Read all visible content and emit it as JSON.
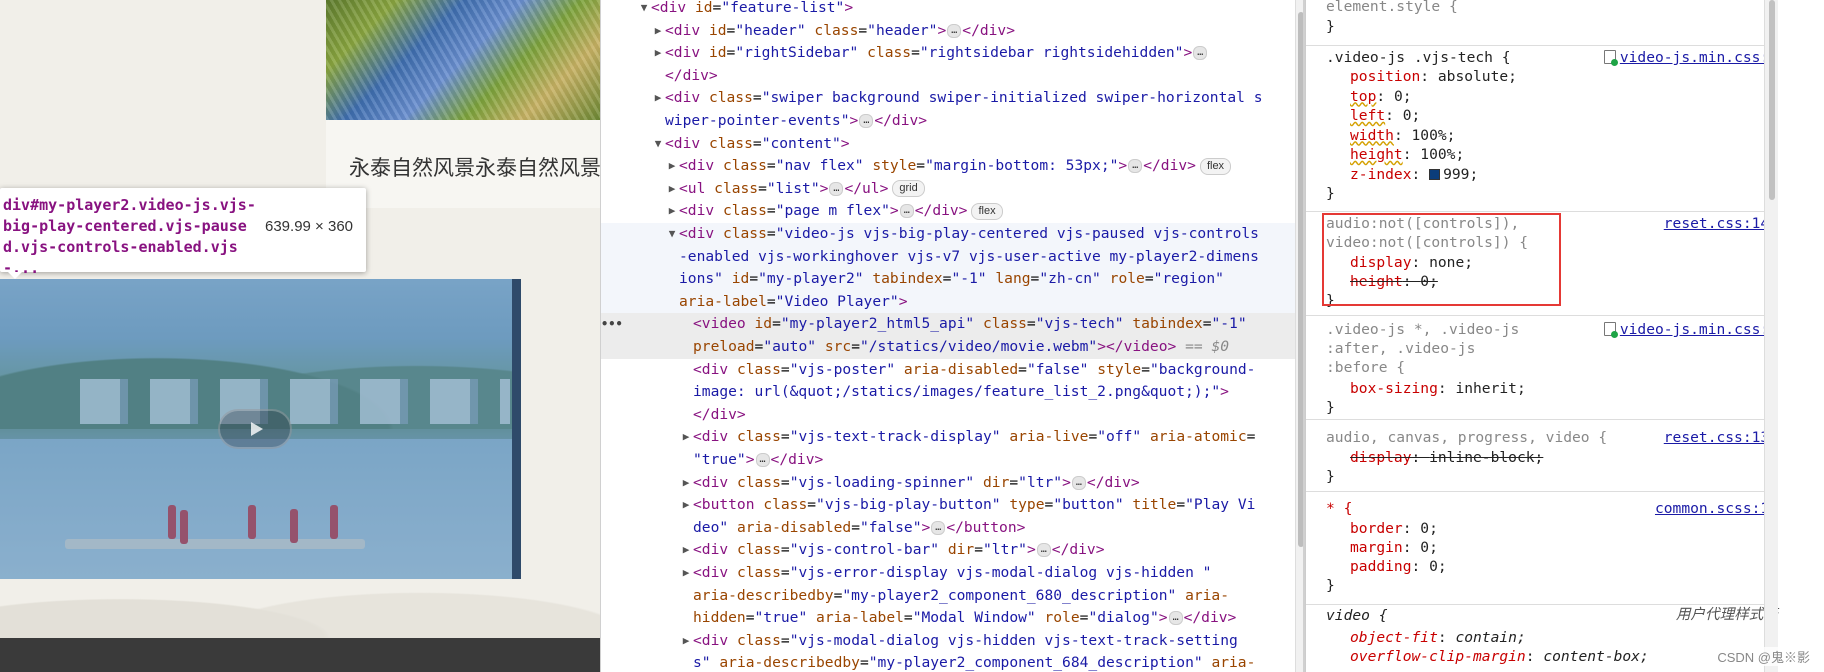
{
  "page": {
    "title_text": "永泰自然风景永泰自然风景"
  },
  "tooltip": {
    "selector": "div#my-player2.video-js.vjs-big-play-centered.vjs-paused.vjs-controls-enabled.vjs-...",
    "dimensions": "639.99 × 360"
  },
  "elements": {
    "rows": [
      {
        "indent": 0,
        "tri": "▼",
        "html": "<span class='t'>&lt;div</span> <span class='an'>id</span>=<span class='av'>\"feature-list\"</span><span class='t'>&gt;</span>"
      },
      {
        "indent": 1,
        "tri": "▶",
        "html": "<span class='t'>&lt;div</span> <span class='an'>id</span>=<span class='av'>\"header\"</span> <span class='an'>class</span>=<span class='av'>\"header\"</span><span class='t'>&gt;</span><span class='ell'>…</span><span class='t'>&lt;/div&gt;</span>"
      },
      {
        "indent": 1,
        "tri": "▶",
        "html": "<span class='t'>&lt;div</span> <span class='an'>id</span>=<span class='av'>\"rightSidebar\"</span> <span class='an'>class</span>=<span class='av'>\"rightsidebar rightsidehidden\"</span><span class='t'>&gt;</span><span class='ell'>…</span>"
      },
      {
        "indent": 1,
        "tri": "",
        "html": "<span class='t'>&lt;/div&gt;</span>"
      },
      {
        "indent": 1,
        "tri": "▶",
        "html": "<span class='t'>&lt;div</span> <span class='an'>class</span>=<span class='av'>\"swiper background swiper-initialized swiper-horizontal s</span>"
      },
      {
        "indent": 1,
        "tri": "",
        "html": "<span class='av'>wiper-pointer-events\"</span><span class='t'>&gt;</span><span class='ell'>…</span><span class='t'>&lt;/div&gt;</span>"
      },
      {
        "indent": 1,
        "tri": "▼",
        "html": "<span class='t'>&lt;div</span> <span class='an'>class</span>=<span class='av'>\"content\"</span><span class='t'>&gt;</span>"
      },
      {
        "indent": 2,
        "tri": "▶",
        "html": "<span class='t'>&lt;div</span> <span class='an'>class</span>=<span class='av'>\"nav flex\"</span> <span class='an'>style</span>=<span class='av'>\"margin-bottom: 53px;\"</span><span class='t'>&gt;</span><span class='ell'>…</span><span class='t'>&lt;/div&gt;</span><span class='badge'>flex</span>"
      },
      {
        "indent": 2,
        "tri": "▶",
        "html": "<span class='t'>&lt;ul</span> <span class='an'>class</span>=<span class='av'>\"list\"</span><span class='t'>&gt;</span><span class='ell'>…</span><span class='t'>&lt;/ul&gt;</span><span class='badge'>grid</span>"
      },
      {
        "indent": 2,
        "tri": "▶",
        "html": "<span class='t'>&lt;div</span> <span class='an'>class</span>=<span class='av'>\"page m flex\"</span><span class='t'>&gt;</span><span class='ell'>…</span><span class='t'>&lt;/div&gt;</span><span class='badge'>flex</span>"
      },
      {
        "indent": 2,
        "tri": "▼",
        "hover": true,
        "html": "<span class='t'>&lt;div</span> <span class='an'>class</span>=<span class='av'>\"video-js vjs-big-play-centered vjs-paused vjs-controls</span>"
      },
      {
        "indent": 2,
        "tri": "",
        "hover": true,
        "html": "<span class='av'>-enabled vjs-workinghover vjs-v7 vjs-user-active my-player2-dimens</span>"
      },
      {
        "indent": 2,
        "tri": "",
        "hover": true,
        "html": "<span class='av'>ions\"</span> <span class='an'>id</span>=<span class='av'>\"my-player2\"</span> <span class='an'>tabindex</span>=<span class='av'>\"-1\"</span> <span class='an'>lang</span>=<span class='av'>\"zh-cn\"</span> <span class='an'>role</span>=<span class='av'>\"region\"</span>"
      },
      {
        "indent": 2,
        "tri": "",
        "hover": true,
        "html": "<span class='an'>aria-label</span>=<span class='av'>\"Video Player\"</span><span class='t'>&gt;</span>"
      },
      {
        "indent": 3,
        "tri": "",
        "sel": true,
        "html": "<span class='t'>&lt;video</span> <span class='an'>id</span>=<span class='av'>\"my-player2_html5_api\"</span> <span class='an'>class</span>=<span class='av'>\"vjs-tech\"</span> <span class='an'>tabindex</span>=<span class='av'>\"-1\"</span>"
      },
      {
        "indent": 3,
        "tri": "",
        "sel": true,
        "html": "<span class='an'>preload</span>=<span class='av'>\"auto\"</span> <span class='an'>src</span>=<span class='av'>\"/statics/video/movie.webm\"</span><span class='t'>&gt;&lt;/video&gt;</span> <span class='eq0'>== $0</span>"
      },
      {
        "indent": 3,
        "tri": "",
        "html": "<span class='t'>&lt;div</span> <span class='an'>class</span>=<span class='av'>\"vjs-poster\"</span> <span class='an'>aria-disabled</span>=<span class='av'>\"false\"</span> <span class='an'>style</span>=<span class='av'>\"background-</span>"
      },
      {
        "indent": 3,
        "tri": "",
        "html": "<span class='av'>image: url(&amp;quot;/statics/images/feature_list_2.png&amp;quot;);\"</span><span class='t'>&gt;</span>"
      },
      {
        "indent": 3,
        "tri": "",
        "html": "<span class='t'>&lt;/div&gt;</span>"
      },
      {
        "indent": 3,
        "tri": "▶",
        "html": "<span class='t'>&lt;div</span> <span class='an'>class</span>=<span class='av'>\"vjs-text-track-display\"</span> <span class='an'>aria-live</span>=<span class='av'>\"off\"</span> <span class='an'>aria-atomic</span>="
      },
      {
        "indent": 3,
        "tri": "",
        "html": "<span class='av'>\"true\"</span><span class='t'>&gt;</span><span class='ell'>…</span><span class='t'>&lt;/div&gt;</span>"
      },
      {
        "indent": 3,
        "tri": "▶",
        "html": "<span class='t'>&lt;div</span> <span class='an'>class</span>=<span class='av'>\"vjs-loading-spinner\"</span> <span class='an'>dir</span>=<span class='av'>\"ltr\"</span><span class='t'>&gt;</span><span class='ell'>…</span><span class='t'>&lt;/div&gt;</span>"
      },
      {
        "indent": 3,
        "tri": "▶",
        "html": "<span class='t'>&lt;button</span> <span class='an'>class</span>=<span class='av'>\"vjs-big-play-button\"</span> <span class='an'>type</span>=<span class='av'>\"button\"</span> <span class='an'>title</span>=<span class='av'>\"Play Vi</span>"
      },
      {
        "indent": 3,
        "tri": "",
        "html": "<span class='av'>deo\"</span> <span class='an'>aria-disabled</span>=<span class='av'>\"false\"</span><span class='t'>&gt;</span><span class='ell'>…</span><span class='t'>&lt;/button&gt;</span>"
      },
      {
        "indent": 3,
        "tri": "▶",
        "html": "<span class='t'>&lt;div</span> <span class='an'>class</span>=<span class='av'>\"vjs-control-bar\"</span> <span class='an'>dir</span>=<span class='av'>\"ltr\"</span><span class='t'>&gt;</span><span class='ell'>…</span><span class='t'>&lt;/div&gt;</span>"
      },
      {
        "indent": 3,
        "tri": "▶",
        "html": "<span class='t'>&lt;div</span> <span class='an'>class</span>=<span class='av'>\"vjs-error-display vjs-modal-dialog vjs-hidden \"</span>"
      },
      {
        "indent": 3,
        "tri": "",
        "html": "<span class='an'>aria-describedby</span>=<span class='av'>\"my-player2_component_680_description\"</span> <span class='an'>aria-</span>"
      },
      {
        "indent": 3,
        "tri": "",
        "html": "<span class='an'>hidden</span>=<span class='av'>\"true\"</span> <span class='an'>aria-label</span>=<span class='av'>\"Modal Window\"</span> <span class='an'>role</span>=<span class='av'>\"dialog\"</span><span class='t'>&gt;</span><span class='ell'>…</span><span class='t'>&lt;/div&gt;</span>"
      },
      {
        "indent": 3,
        "tri": "▶",
        "html": "<span class='t'>&lt;div</span> <span class='an'>class</span>=<span class='av'>\"vjs-modal-dialog vjs-hidden  vjs-text-track-setting</span>"
      },
      {
        "indent": 3,
        "tri": "",
        "html": "<span class='av'>s\"</span> <span class='an'>aria-describedby</span>=<span class='av'>\"my-player2_component_684_description\"</span> <span class='an'>aria-</span>"
      }
    ],
    "ellipsis_gutter": "•••"
  },
  "styles": {
    "element_style": "element.style {",
    "close_brace": "}",
    "rule1": {
      "selector": ".video-js .vjs-tech {",
      "source": "video-js.min.css:1",
      "props": [
        {
          "name": "position",
          "value": "absolute;"
        },
        {
          "name": "top",
          "value": "0;",
          "wavy": true
        },
        {
          "name": "left",
          "value": "0;",
          "wavy": true
        },
        {
          "name": "width",
          "value": "100%;",
          "wavy": true
        },
        {
          "name": "height",
          "value": "100%;",
          "wavy": true
        },
        {
          "name": "z-index",
          "value": "999;"
        }
      ]
    },
    "rule2": {
      "selector_l1": "audio:not([controls]),",
      "selector_l2": "video:not([controls]) {",
      "source": "reset.css:140",
      "prop1_name": "display",
      "prop1_value": "none;",
      "prop2_name": "height",
      "prop2_value": "0;"
    },
    "rule3": {
      "selector_l1": ".video-js *, .video-js",
      "selector_l2": ":after, .video-js",
      "selector_l3": ":before {",
      "source": "video-js.min.css:1",
      "prop_name": "box-sizing",
      "prop_value": "inherit;"
    },
    "rule4": {
      "selector": "audio, canvas, progress, video {",
      "source": "reset.css:133",
      "prop_name": "display",
      "prop_value": "inline-block;"
    },
    "rule5": {
      "selector": "* {",
      "source": "common.scss:17",
      "props": [
        {
          "name": "border",
          "value": "0;"
        },
        {
          "name": "margin",
          "value": "0;"
        },
        {
          "name": "padding",
          "value": "0;"
        }
      ]
    },
    "rule6": {
      "selector": "video {",
      "source": "用户代理样式表",
      "props": [
        {
          "name": "object-fit",
          "value": "contain;"
        },
        {
          "name": "overflow-clip-margin",
          "value": "content-box;"
        }
      ]
    },
    "watermark": "CSDN @鬼※影"
  },
  "colors": {
    "tag": "#881280",
    "attr_name": "#994500",
    "attr_value": "#1a1aa6",
    "css_prop": "#c80000",
    "highlight_box": "#e53935"
  }
}
